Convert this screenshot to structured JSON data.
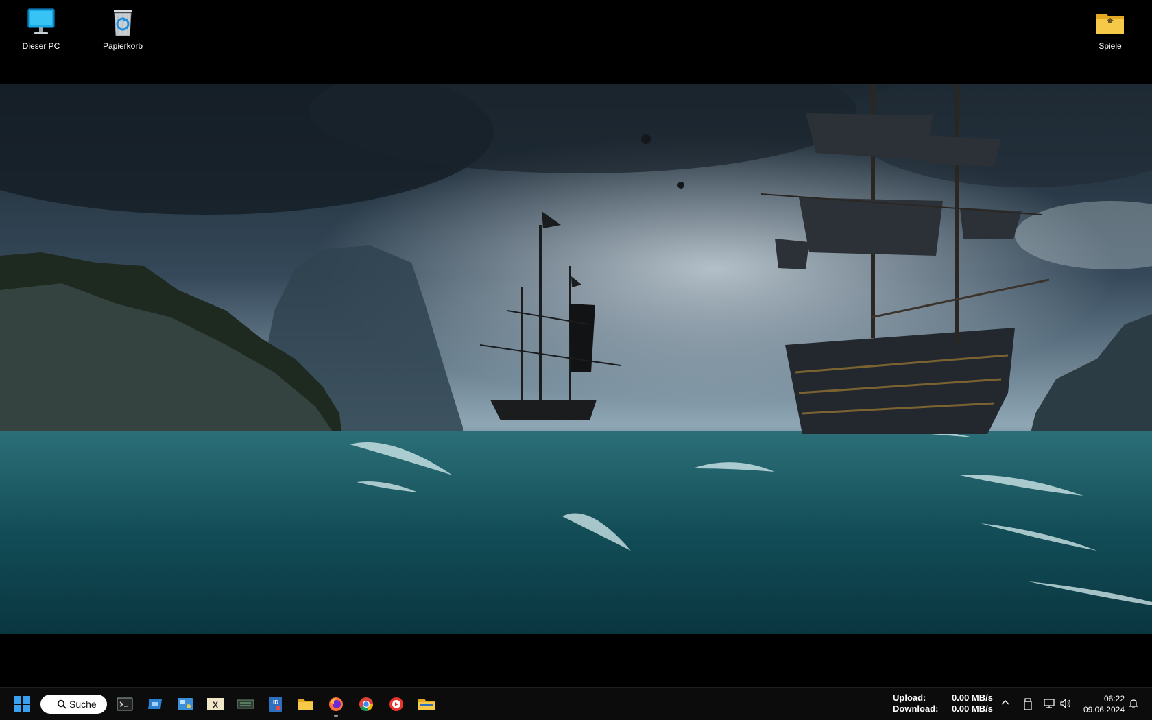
{
  "desktop": {
    "icons": [
      {
        "label": "Dieser PC",
        "icon": "monitor-icon"
      },
      {
        "label": "Papierkorb",
        "icon": "recycle-bin-icon"
      },
      {
        "label": "Spiele",
        "icon": "folder-icon"
      }
    ]
  },
  "wallpaper": {
    "subject": "pirate-ships-stormy-sea"
  },
  "taskbar": {
    "search_label": "Suche",
    "apps": [
      {
        "icon": "terminal-icon",
        "active": false
      },
      {
        "icon": "remote-desktop-icon",
        "active": false
      },
      {
        "icon": "control-panel-icon",
        "active": false
      },
      {
        "icon": "xmind-icon",
        "active": false
      },
      {
        "icon": "chip-tool-icon",
        "active": false
      },
      {
        "icon": "id-card-icon",
        "active": false
      },
      {
        "icon": "file-explorer-icon",
        "active": false
      },
      {
        "icon": "firefox-icon",
        "active": true
      },
      {
        "icon": "chrome-icon",
        "active": false
      },
      {
        "icon": "media-player-icon",
        "active": false
      },
      {
        "icon": "folder-icon",
        "active": false
      }
    ],
    "network": {
      "upload_label": "Upload:",
      "upload_value": "0.00 MB/s",
      "download_label": "Download:",
      "download_value": "0.00 MB/s"
    },
    "clock": {
      "time": "06:22",
      "date": "09.06.2024"
    }
  },
  "colors": {
    "taskbar_bg": "#0c0c0c",
    "windows_blue": "#1e90ff",
    "folder_yellow": "#f7c948"
  }
}
